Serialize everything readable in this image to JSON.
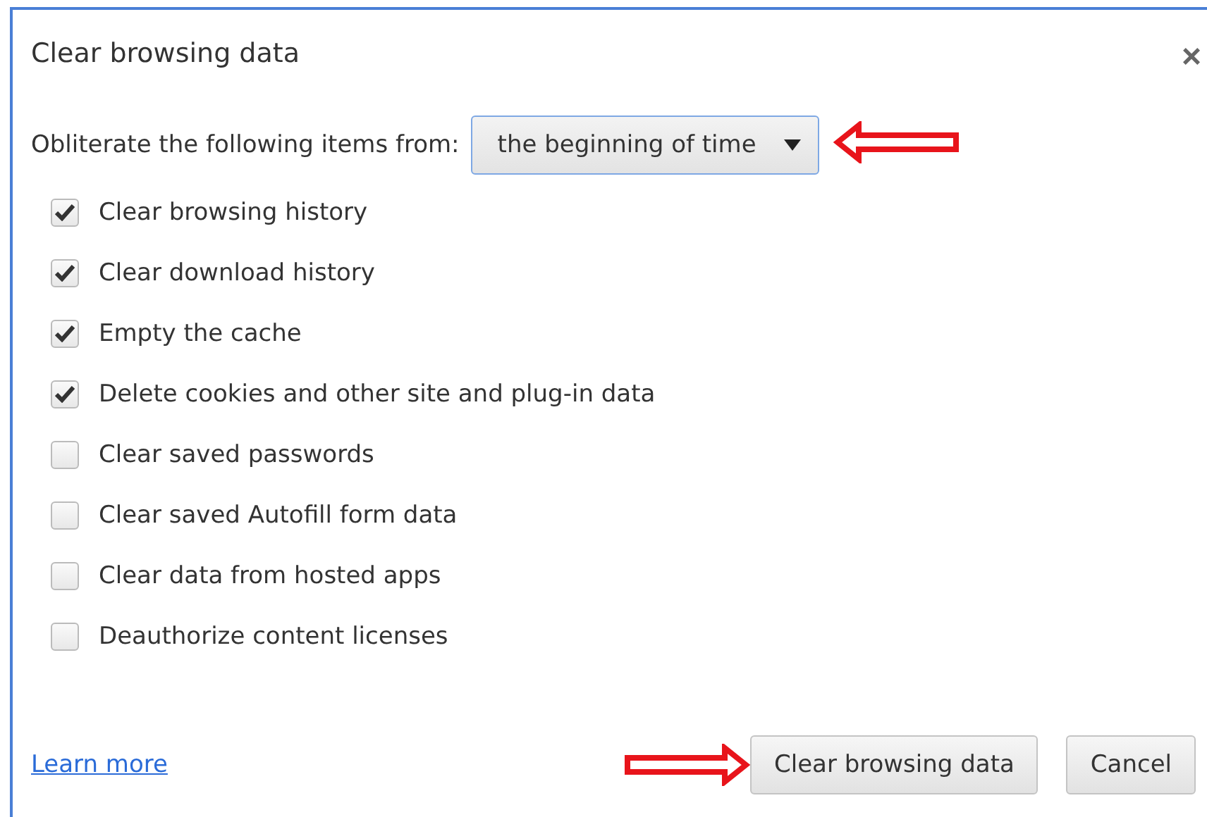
{
  "dialog": {
    "title": "Clear browsing data",
    "close": "×"
  },
  "range": {
    "label": "Obliterate the following items from:",
    "value": "the beginning of time"
  },
  "items": [
    {
      "label": "Clear browsing history",
      "checked": true
    },
    {
      "label": "Clear download history",
      "checked": true
    },
    {
      "label": "Empty the cache",
      "checked": true
    },
    {
      "label": "Delete cookies and other site and plug-in data",
      "checked": true
    },
    {
      "label": "Clear saved passwords",
      "checked": false
    },
    {
      "label": "Clear saved Autofill form data",
      "checked": false
    },
    {
      "label": "Clear data from hosted apps",
      "checked": false
    },
    {
      "label": "Deauthorize content licenses",
      "checked": false
    }
  ],
  "footer": {
    "link": "Learn more",
    "buttons": [
      {
        "label": "Clear browsing data",
        "kind": "primary"
      },
      {
        "label": "Cancel",
        "kind": "secondary"
      }
    ]
  }
}
